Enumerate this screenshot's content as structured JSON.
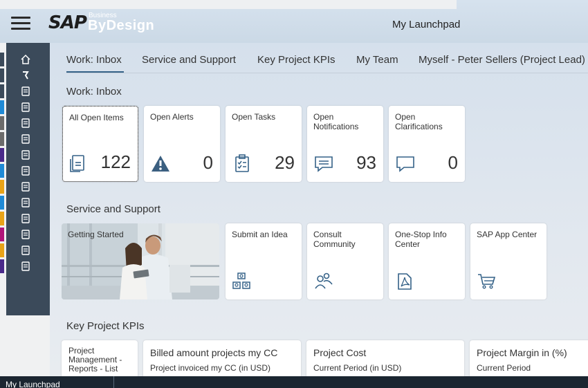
{
  "shell": {
    "brand": "SAP",
    "brand_super": "Business",
    "brand_product": "ByDesign",
    "title": "My Launchpad"
  },
  "tabs": [
    {
      "label": "Work: Inbox",
      "active": true
    },
    {
      "label": "Service and Support"
    },
    {
      "label": "Key Project KPIs"
    },
    {
      "label": "My Team"
    },
    {
      "label": "Myself - Peter Sellers (Project Lead)"
    }
  ],
  "sections": {
    "inbox": "Work: Inbox",
    "service": "Service and Support",
    "kpis": "Key Project KPIs"
  },
  "inbox_tiles": [
    {
      "title": "All Open Items",
      "count": "122",
      "icon": "document-list-icon"
    },
    {
      "title": "Open Alerts",
      "count": "0",
      "icon": "alert-icon"
    },
    {
      "title": "Open Tasks",
      "count": "29",
      "icon": "task-clipboard-icon"
    },
    {
      "title": "Open Notifications",
      "count": "93",
      "icon": "message-icon"
    },
    {
      "title": "Open Clarifications",
      "count": "0",
      "icon": "chat-bubble-icon"
    }
  ],
  "service_tiles": [
    {
      "title": "Getting Started",
      "icon": "photo"
    },
    {
      "title": "Submit an Idea",
      "icon": "idea-network-icon"
    },
    {
      "title": "Consult Community",
      "icon": "community-icon"
    },
    {
      "title": "One-Stop Info Center",
      "icon": "pdf-document-icon"
    },
    {
      "title": "SAP App Center",
      "icon": "cart-icon"
    }
  ],
  "kpi_tiles": [
    {
      "title": "Project Management - Reports - List",
      "subtitle": ""
    },
    {
      "title": "Billed amount projects my CC",
      "subtitle": "Project invoiced my CC (in USD)"
    },
    {
      "title": "Project Cost",
      "subtitle": "Current Period (in USD)"
    },
    {
      "title": "Project Margin in (%)",
      "subtitle": "Current Period"
    }
  ],
  "taskbar": {
    "item": "My Launchpad"
  },
  "colors": {
    "sidebar_bg": "#3b4a5a",
    "tab_underline": "#346187",
    "taskbar_bg": "#1b2631",
    "icon_color": "#346187",
    "alert_icon": "#3b5f80",
    "sidebar_accents": [
      "#3b4a5a",
      "#3b4a5a",
      "#3b4a5a",
      "#1f8ad6",
      "#6b6b6b",
      "#6b6b6b",
      "#4a2a8a",
      "#1f8ad6",
      "#e8a317",
      "#1f8ad6",
      "#e8a317",
      "#b0157a",
      "#e8a317",
      "#4a2a8a"
    ]
  }
}
